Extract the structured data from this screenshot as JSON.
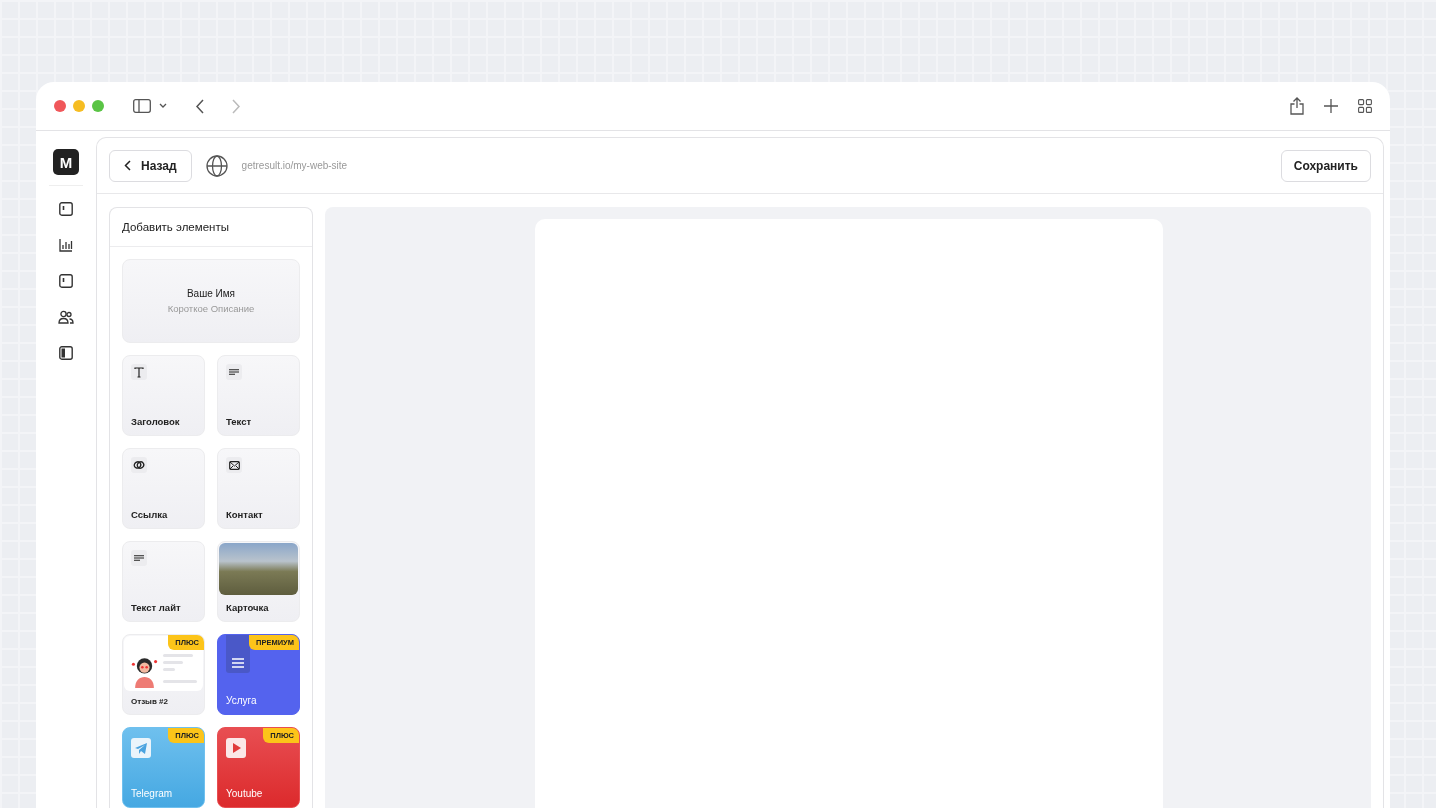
{
  "app_logo": "M",
  "header": {
    "back_button": "Назад",
    "site_url": "getresult.io/my-web-site",
    "save_button": "Сохранить"
  },
  "panel": {
    "title": "Добавить элементы",
    "profile_card": {
      "name": "Ваше Имя",
      "description": "Короткое Описание"
    },
    "elements": [
      {
        "kind": "heading",
        "label": "Заголовок"
      },
      {
        "kind": "text",
        "label": "Текст"
      },
      {
        "kind": "link",
        "label": "Ссылка"
      },
      {
        "kind": "contact",
        "label": "Контакт"
      },
      {
        "kind": "textlite",
        "label": "Текст лайт"
      },
      {
        "kind": "photo",
        "label": "Карточка"
      },
      {
        "kind": "review",
        "label": "Отзыв #2",
        "badge": "ПЛЮС"
      },
      {
        "kind": "service",
        "label": "Услуга",
        "badge": "ПРЕМИУМ"
      },
      {
        "kind": "telegram",
        "label": "Telegram",
        "badge": "ПЛЮС"
      },
      {
        "kind": "youtube",
        "label": "Youtube",
        "badge": "ПЛЮС"
      }
    ]
  }
}
